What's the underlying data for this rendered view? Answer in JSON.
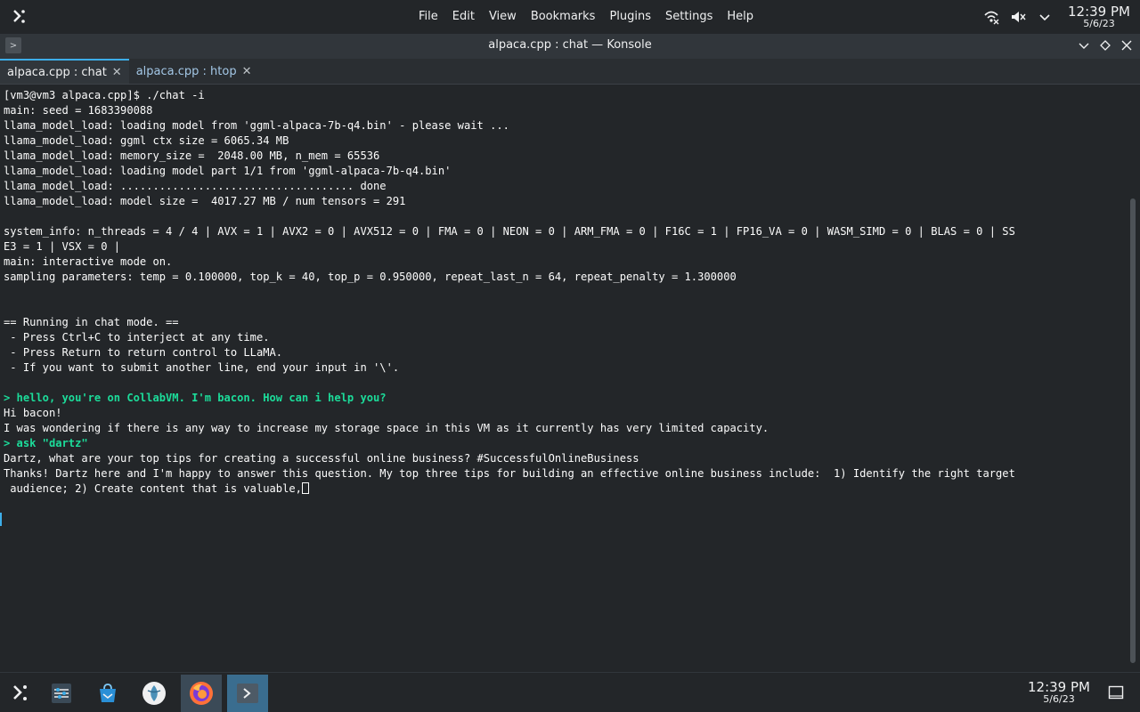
{
  "top_panel": {
    "launcher_icon": "kde-launcher-icon",
    "menu": [
      "File",
      "Edit",
      "View",
      "Bookmarks",
      "Plugins",
      "Settings",
      "Help"
    ],
    "tray_icons": [
      "network-icon",
      "volume-muted-icon",
      "chevron-down-icon"
    ],
    "clock": {
      "time": "12:39 PM",
      "date": "5/6/23"
    }
  },
  "window": {
    "title": "alpaca.cpp : chat — Konsole"
  },
  "tabs": [
    {
      "label": "alpaca.cpp : chat",
      "active": true
    },
    {
      "label": "alpaca.cpp : htop",
      "active": false
    }
  ],
  "terminal": {
    "lines": [
      {
        "text": "[vm3@vm3 alpaca.cpp]$ ./chat -i",
        "kind": "normal"
      },
      {
        "text": "main: seed = 1683390088",
        "kind": "normal"
      },
      {
        "text": "llama_model_load: loading model from 'ggml-alpaca-7b-q4.bin' - please wait ...",
        "kind": "normal"
      },
      {
        "text": "llama_model_load: ggml ctx size = 6065.34 MB",
        "kind": "normal"
      },
      {
        "text": "llama_model_load: memory_size =  2048.00 MB, n_mem = 65536",
        "kind": "normal"
      },
      {
        "text": "llama_model_load: loading model part 1/1 from 'ggml-alpaca-7b-q4.bin'",
        "kind": "normal"
      },
      {
        "text": "llama_model_load: .................................... done",
        "kind": "normal"
      },
      {
        "text": "llama_model_load: model size =  4017.27 MB / num tensors = 291",
        "kind": "normal"
      },
      {
        "text": "",
        "kind": "normal"
      },
      {
        "text": "system_info: n_threads = 4 / 4 | AVX = 1 | AVX2 = 0 | AVX512 = 0 | FMA = 0 | NEON = 0 | ARM_FMA = 0 | F16C = 1 | FP16_VA = 0 | WASM_SIMD = 0 | BLAS = 0 | SS",
        "kind": "normal"
      },
      {
        "text": "E3 = 1 | VSX = 0 |",
        "kind": "normal"
      },
      {
        "text": "main: interactive mode on.",
        "kind": "normal"
      },
      {
        "text": "sampling parameters: temp = 0.100000, top_k = 40, top_p = 0.950000, repeat_last_n = 64, repeat_penalty = 1.300000",
        "kind": "normal"
      },
      {
        "text": "",
        "kind": "normal"
      },
      {
        "text": "",
        "kind": "normal"
      },
      {
        "text": "== Running in chat mode. ==",
        "kind": "normal"
      },
      {
        "text": " - Press Ctrl+C to interject at any time.",
        "kind": "normal"
      },
      {
        "text": " - Press Return to return control to LLaMA.",
        "kind": "normal"
      },
      {
        "text": " - If you want to submit another line, end your input in '\\'.",
        "kind": "normal"
      },
      {
        "text": "",
        "kind": "normal"
      },
      {
        "text": "> hello, you're on CollabVM. I'm bacon. How can i help you?",
        "kind": "user"
      },
      {
        "text": "Hi bacon!",
        "kind": "normal"
      },
      {
        "text": "I was wondering if there is any way to increase my storage space in this VM as it currently has very limited capacity.",
        "kind": "normal"
      },
      {
        "text": "> ask \"dartz\"",
        "kind": "user"
      },
      {
        "text": "Dartz, what are your top tips for creating a successful online business? #SuccessfulOnlineBusiness",
        "kind": "normal"
      },
      {
        "text": "Thanks! Dartz here and I'm happy to answer this question. My top three tips for building an effective online business include:  1) Identify the right target",
        "kind": "normal"
      },
      {
        "text": " audience; 2) Create content that is valuable,",
        "kind": "cursor"
      }
    ]
  },
  "taskbar": {
    "items": [
      {
        "name": "application-launcher-icon"
      },
      {
        "name": "system-settings-icon"
      },
      {
        "name": "discover-store-icon"
      },
      {
        "name": "steam-deck-icon"
      },
      {
        "name": "firefox-icon"
      },
      {
        "name": "konsole-icon"
      }
    ],
    "clock": {
      "time": "12:39 PM",
      "date": "5/6/23"
    }
  }
}
